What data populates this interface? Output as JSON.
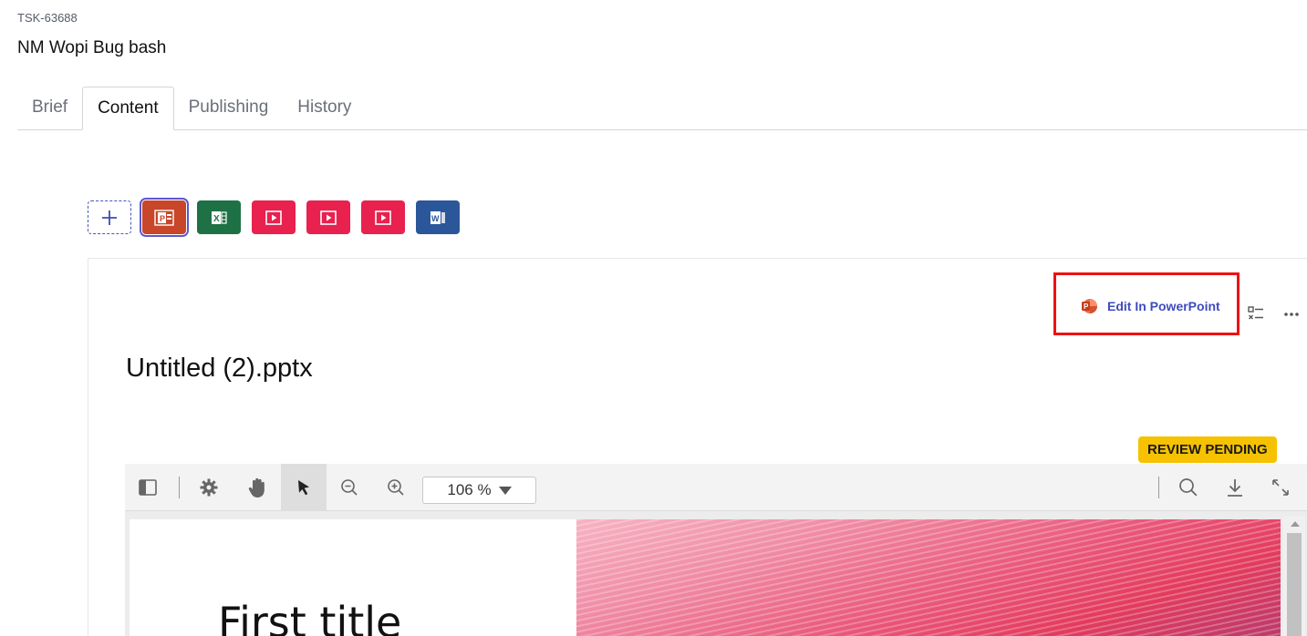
{
  "task": {
    "id": "TSK-63688",
    "title": "NM Wopi Bug bash"
  },
  "tabs": [
    {
      "label": "Brief"
    },
    {
      "label": "Content"
    },
    {
      "label": "Publishing"
    },
    {
      "label": "History"
    }
  ],
  "active_tab": "Content",
  "assets": [
    {
      "type": "add",
      "icon": "plus-icon"
    },
    {
      "type": "powerpoint",
      "icon": "powerpoint-icon",
      "color": "#c8462a",
      "selected": true
    },
    {
      "type": "excel",
      "icon": "excel-icon",
      "color": "#1e7145"
    },
    {
      "type": "video",
      "icon": "play-icon",
      "color": "#e8214e"
    },
    {
      "type": "video",
      "icon": "play-icon",
      "color": "#e8214e"
    },
    {
      "type": "video",
      "icon": "play-icon",
      "color": "#e8214e"
    },
    {
      "type": "word",
      "icon": "word-icon",
      "color": "#2b579a"
    }
  ],
  "content": {
    "edit_button_label": "Edit In PowerPoint",
    "file_title": "Untitled (2).pptx",
    "status_badge": "REVIEW PENDING",
    "status_color": "#f6c200",
    "highlight_color": "#ee1111"
  },
  "viewer": {
    "zoom_label": "106 %",
    "tools": [
      "sidebar-toggle-icon",
      "settings-gear-icon",
      "hand-pan-icon",
      "pointer-arrow-icon",
      "zoom-out-icon",
      "zoom-in-icon",
      "search-icon",
      "download-icon",
      "fullscreen-icon"
    ],
    "active_tool": "pointer-arrow-icon",
    "slide_title": "First title"
  }
}
